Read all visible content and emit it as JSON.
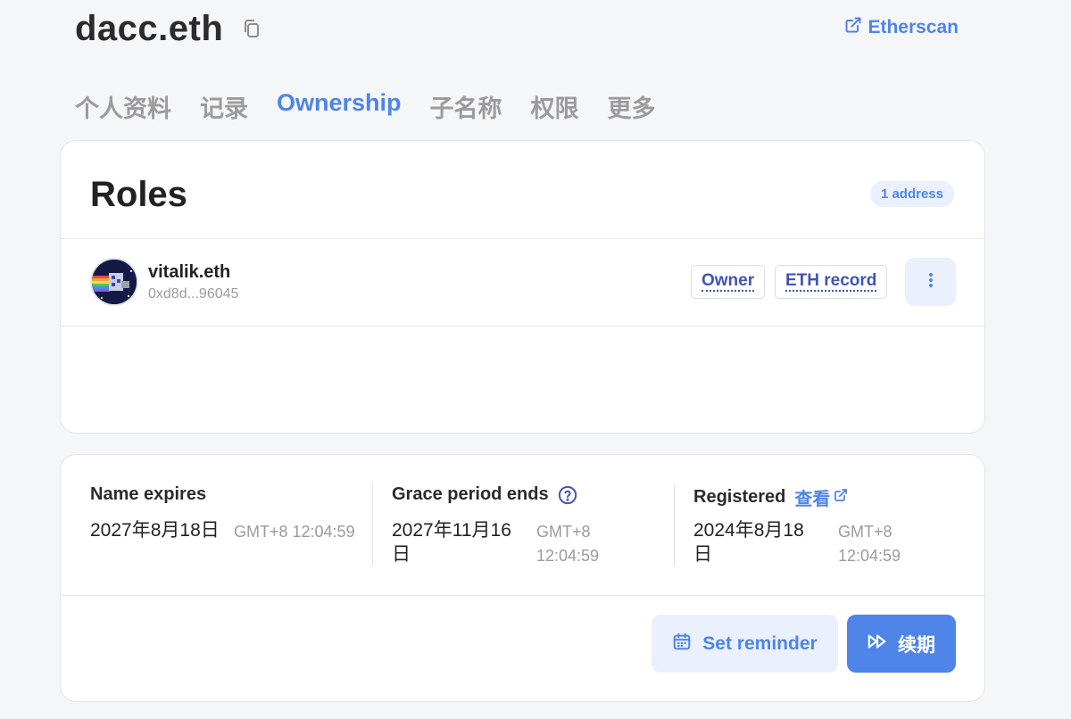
{
  "header": {
    "title": "dacc.eth",
    "etherscan_label": "Etherscan"
  },
  "tabs": [
    {
      "label": "个人资料",
      "active": false
    },
    {
      "label": "记录",
      "active": false
    },
    {
      "label": "Ownership",
      "active": true
    },
    {
      "label": "子名称",
      "active": false
    },
    {
      "label": "权限",
      "active": false
    },
    {
      "label": "更多",
      "active": false
    }
  ],
  "roles": {
    "title": "Roles",
    "badge": "1 address",
    "entries": [
      {
        "name": "vitalik.eth",
        "address": "0xd8d...96045",
        "tags": [
          "Owner",
          "ETH record"
        ]
      }
    ]
  },
  "expiry": {
    "name_expires": {
      "label": "Name expires",
      "date": "2027年8月18日",
      "time": "GMT+8 12:04:59"
    },
    "grace_period": {
      "label": "Grace period ends",
      "date_line1": "2027年11月16",
      "date_line2": "日",
      "time_line1": "GMT+8",
      "time_line2": "12:04:59"
    },
    "registered": {
      "label": "Registered",
      "view_label": "查看",
      "date_line1": "2024年8月18",
      "date_line2": "日",
      "time_line1": "GMT+8",
      "time_line2": "12:04:59"
    }
  },
  "actions": {
    "reminder_label": "Set reminder",
    "renew_label": "续期"
  },
  "colors": {
    "accent": "#4f84e8",
    "accent_light": "#eaf1fd",
    "tag_text": "#3f55b5",
    "muted": "#9b9b9b"
  }
}
